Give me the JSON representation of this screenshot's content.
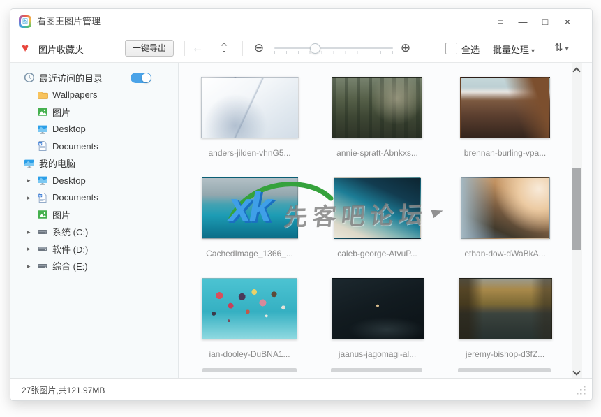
{
  "app": {
    "title": "看图王图片管理"
  },
  "icons": {
    "menu": "≡",
    "minimize": "—",
    "maximize": "□",
    "close": "×",
    "heart": "♥",
    "back": "←",
    "up_home": "⇧",
    "zoom_out": "⊖",
    "zoom_in": "⊕",
    "caret_down": "▾",
    "sort": "⇅",
    "expand_arrow": "▸"
  },
  "toolbar": {
    "favorites_label": "图片收藏夹",
    "export_button": "一键导出",
    "select_all_label": "全选",
    "batch_process_button": "批量处理",
    "zoom_slider": {
      "value_fraction": 0.34
    }
  },
  "sidebar": {
    "recent_section": {
      "label": "最近访问的目录",
      "toggle_on": true
    },
    "recent_items": [
      {
        "label": "Wallpapers",
        "icon": "folder-icon"
      },
      {
        "label": "图片",
        "icon": "image-icon"
      },
      {
        "label": "Desktop",
        "icon": "monitor-icon"
      },
      {
        "label": "Documents",
        "icon": "document-icon"
      }
    ],
    "computer_section": {
      "label": "我的电脑"
    },
    "computer_items": [
      {
        "label": "Desktop",
        "icon": "monitor-icon",
        "expandable": true
      },
      {
        "label": "Documents",
        "icon": "document-icon",
        "expandable": true
      },
      {
        "label": "图片",
        "icon": "image-icon",
        "expandable": false
      },
      {
        "label": "系统 (C:)",
        "icon": "drive-icon",
        "expandable": true
      },
      {
        "label": "软件 (D:)",
        "icon": "drive-icon",
        "expandable": true
      },
      {
        "label": "综合 (E:)",
        "icon": "drive-icon",
        "expandable": true
      }
    ]
  },
  "gallery": {
    "items": [
      {
        "filename": "anders-jilden-vhnG5..."
      },
      {
        "filename": "annie-spratt-Abnkxs..."
      },
      {
        "filename": "brennan-burling-vpa..."
      },
      {
        "filename": "CachedImage_1366_..."
      },
      {
        "filename": "caleb-george-AtvuP..."
      },
      {
        "filename": "ethan-dow-dWaBkA..."
      },
      {
        "filename": "ian-dooley-DuBNA1..."
      },
      {
        "filename": "jaanus-jagomagi-al..."
      },
      {
        "filename": "jeremy-bishop-d3fZ..."
      }
    ]
  },
  "watermark": {
    "logo_text": "xk",
    "forum_text": "先客吧论坛"
  },
  "statusbar": {
    "text": "27张图片,共121.97MB"
  },
  "colors": {
    "accent_blue": "#4aa3e8",
    "heart_red": "#e8453c",
    "toggle_blue": "#4aa3e8"
  }
}
